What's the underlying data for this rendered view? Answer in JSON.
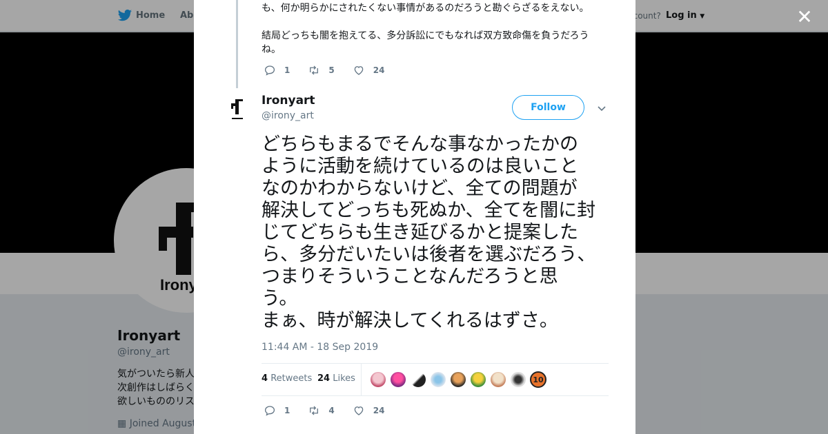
{
  "nav": {
    "home_label": "Home",
    "about_label": "Abo",
    "account_prompt": "ccount?",
    "login_label": "Log in"
  },
  "background_profile": {
    "name": "Ironyart",
    "handle": "@irony_art",
    "bio_lines": [
      "気がついたら新人",
      "次創作はしばらく",
      "欲しいもののリス"
    ],
    "joined": "Joined August"
  },
  "previous_tweet": {
    "text_lines": [
      "も、何か明らかにされたくない事情があるのだろうと勘ぐらざるをえない。",
      "結局どっちも闇を抱えてる、多分訴訟にでもなれば双方致命傷を負うだろうね。"
    ],
    "replies": "1",
    "retweets": "5",
    "likes": "24"
  },
  "tweet": {
    "author_name": "Ironyart",
    "author_handle": "@irony_art",
    "follow_label": "Follow",
    "text": "どちらもまるでそんな事なかったかの\nように活動を続けているのは良いこと\nなのかわからないけど、全ての問題が\n解決してどっちも死ぬか、全てを闇に封\nじてどちらも生き延びるかと提案した\nら、多分だいたいは後者を選ぶだろう、\nつまりそういうことなんだろうと思\nう。\nまぁ、時が解決してくれるはずさ。",
    "timestamp": "11:44 AM - 18 Sep 2019",
    "retweets_count": "4",
    "retweets_label": "Retweets",
    "likes_count": "24",
    "likes_label": "Likes",
    "replies": "1",
    "retweets": "4",
    "likes": "24"
  },
  "liker_badge": "10",
  "colors": {
    "accent": "#1da1f2",
    "muted": "#657786"
  }
}
